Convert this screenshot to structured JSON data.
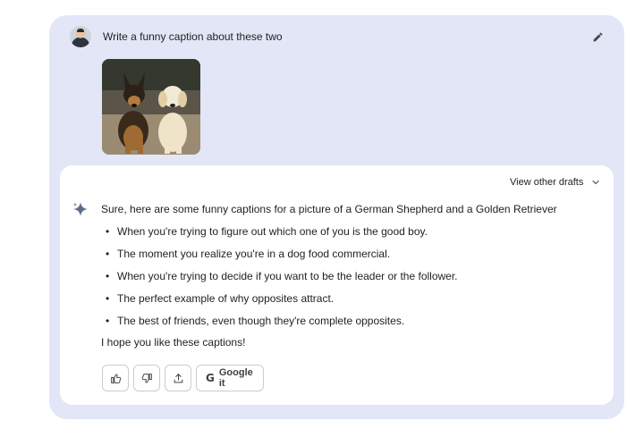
{
  "prompt": {
    "text": "Write a funny caption about these two"
  },
  "response": {
    "drafts_label": "View other drafts",
    "intro": "Sure, here are some funny captions for a picture of a German Shepherd and a Golden Retriever",
    "captions": [
      "When you're trying to figure out which one of you is the good boy.",
      "The moment you realize you're in a dog food commercial.",
      "When you're trying to decide if you want to be the leader or the follower.",
      "The perfect example of why opposites attract.",
      "The best of friends, even though they're complete opposites."
    ],
    "closing": "I hope you like these captions!"
  },
  "actions": {
    "google_label": "Google it"
  },
  "icons": {
    "edit": "pencil-icon",
    "drafts": "chevron-down-icon",
    "assistant": "sparkle-icon",
    "like": "thumbs-up-icon",
    "dislike": "thumbs-down-icon",
    "share": "share-icon",
    "google": "google-g-icon"
  },
  "colors": {
    "outer_background": "#e3e6f6",
    "inner_background": "#ffffff",
    "text": "#1f1f1f",
    "sparkle": "#5f6b8a"
  }
}
